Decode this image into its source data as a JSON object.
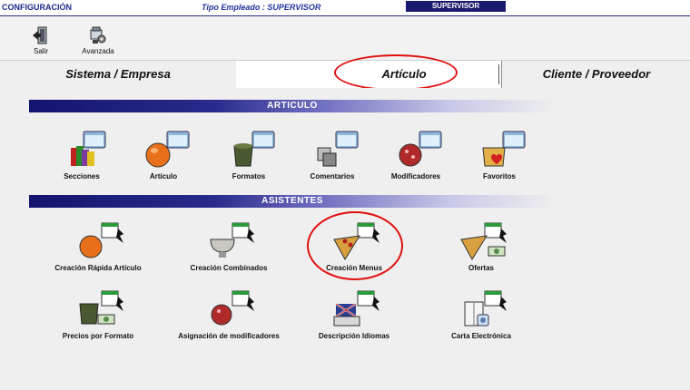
{
  "topbar": {
    "section": "CONFIGURACIÓN",
    "tipo_empleado": "Tipo Empleado : SUPERVISOR",
    "user_badge": "SUPERVISOR"
  },
  "toolbar": {
    "salir": "Salir",
    "avanzada": "Avanzada"
  },
  "tabs": [
    {
      "label": "Sistema / Empresa"
    },
    {
      "label": "Artículo"
    },
    {
      "label": "Cliente / Proveedor"
    }
  ],
  "sections": {
    "articulo": {
      "title": "ARTICULO",
      "items": [
        {
          "label": "Secciones",
          "icon": "sections-folder-icon"
        },
        {
          "label": "Artículo",
          "icon": "orange-folder-icon"
        },
        {
          "label": "Formatos",
          "icon": "jar-folder-icon"
        },
        {
          "label": "Comentarios",
          "icon": "comments-folder-icon"
        },
        {
          "label": "Modificadores",
          "icon": "berry-folder-icon"
        },
        {
          "label": "Favoritos",
          "icon": "favorites-folder-icon"
        }
      ]
    },
    "asistentes": {
      "title": "ASISTENTES",
      "items": [
        {
          "label": "Creación Rápida Artículo",
          "icon": "orange-wizard-icon"
        },
        {
          "label": "Creación Combinados",
          "icon": "bowl-wizard-icon"
        },
        {
          "label": "Creación Menus",
          "icon": "pizza-wizard-icon"
        },
        {
          "label": "Ofertas",
          "icon": "pizza-money-wizard-icon"
        },
        {
          "label": "Precios por Formato",
          "icon": "jar-money-wizard-icon"
        },
        {
          "label": "Asignación de modificadores",
          "icon": "berry-wizard-icon"
        },
        {
          "label": "Descripción Idiomas",
          "icon": "languages-wizard-icon"
        },
        {
          "label": "Carta Electrónica",
          "icon": "electronic-menu-wizard-icon"
        }
      ]
    }
  },
  "colors": {
    "accent_navy": "#1a1a6e",
    "highlight_red": "#e01010"
  }
}
